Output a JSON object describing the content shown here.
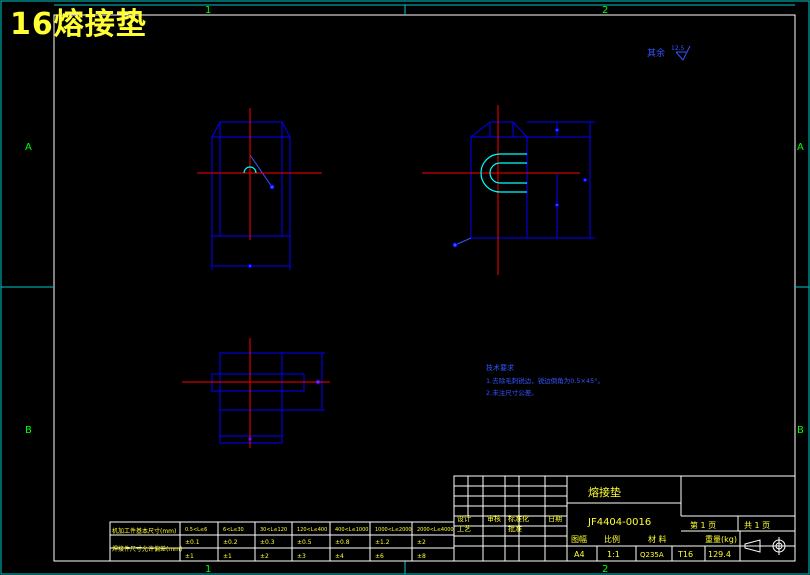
{
  "overlay_title": "16熔接垫",
  "zone_labels": {
    "col1": "1",
    "col2": "2",
    "rowA": "A",
    "rowB": "B"
  },
  "roughness": {
    "label": "其余",
    "value": "12.5"
  },
  "tech_requirements": {
    "title": "技术要求",
    "line1": "1.去除毛刺锐边，锐边倒角为0.5×45°。",
    "line2": "2.未注尺寸公差。"
  },
  "tolerance_table": {
    "row1_label": "机加工件基本尺寸(mm)",
    "row2_label": "焊接件尺寸允许偏差(mm)",
    "headers": [
      "0.5<L≤6",
      "6<L≤30",
      "30<L≤120",
      "120<L≤400",
      "400<L≤1000",
      "1000<L≤2000",
      "2000<L≤4000"
    ],
    "row1": [
      "±0.1",
      "±0.2",
      "±0.3",
      "±0.5",
      "±0.8",
      "±1.2",
      "±2"
    ],
    "row2": [
      "±1",
      "±1",
      "±2",
      "±3",
      "±4",
      "±6",
      "±8"
    ]
  },
  "title_block": {
    "part_name": "熔接垫",
    "drawing_no": "JF4404-0016",
    "sheet_label": "第 1 页",
    "total_label": "共 1 页",
    "format_label": "图幅",
    "scale_label": "比例",
    "material_label": "材 料",
    "weight_label": "重量(kg)",
    "format_value": "A4",
    "scale_value": "1:1",
    "material_value": "Q235A",
    "thickness_value": "T16",
    "weight_value": "129.4",
    "labels": {
      "designer": "设计",
      "checker": "审核",
      "standard": "标准化",
      "approve": "批准",
      "process": "工艺",
      "date": "日期"
    }
  },
  "colors": {
    "outline": "#0000ff",
    "center": "#ff0000",
    "frame": "#ffffff",
    "border": "#ffffff",
    "annot": "#00ffff",
    "text_yellow": "#ffff33"
  }
}
